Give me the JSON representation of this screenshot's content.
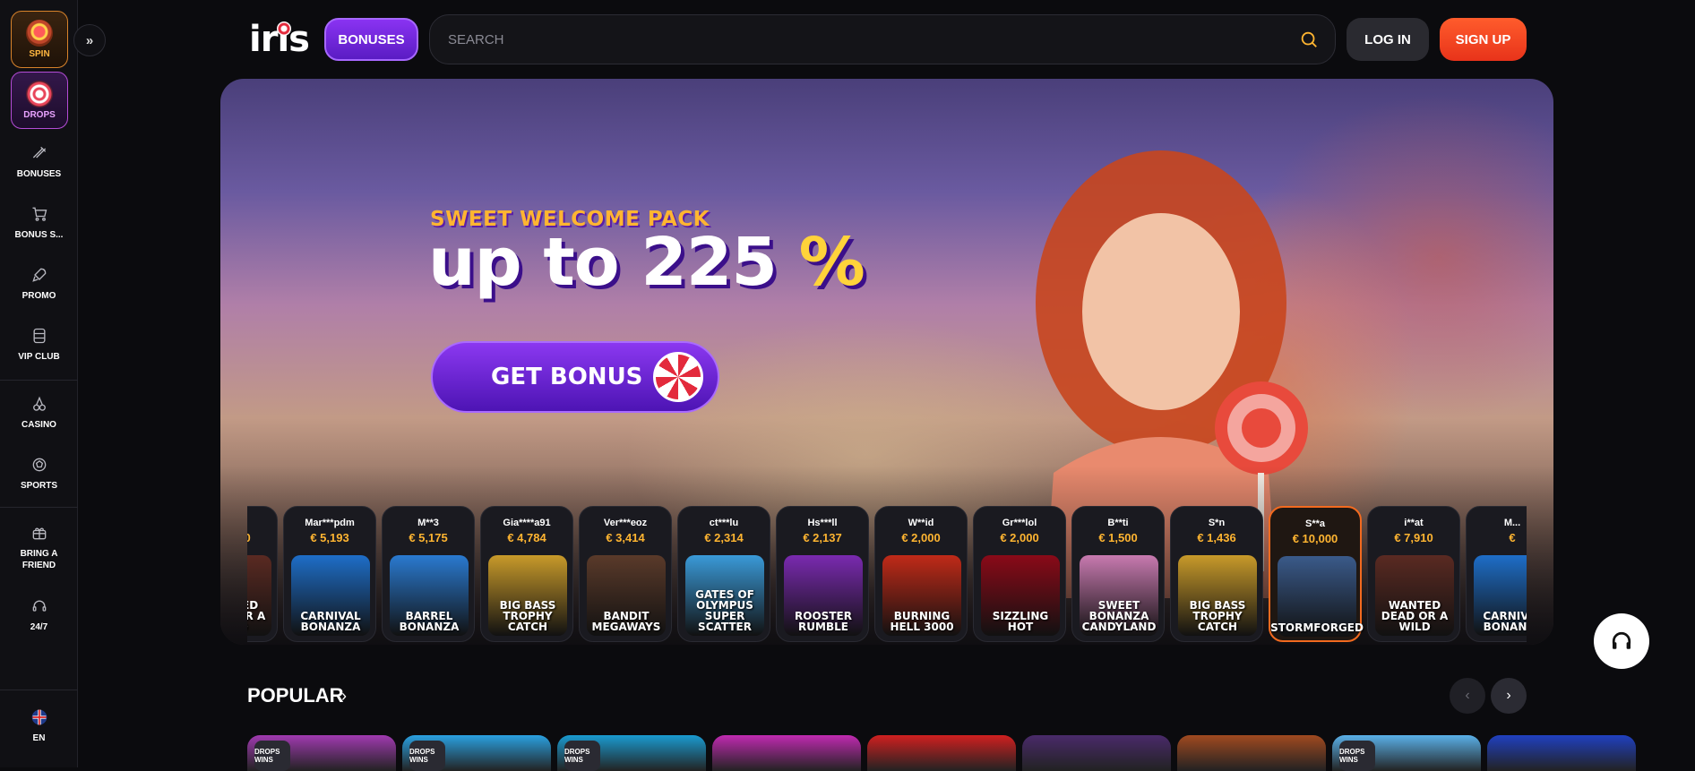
{
  "sidebar": {
    "spin_label": "SPIN",
    "drops_label": "DROPS",
    "items": [
      {
        "label": "BONUSES",
        "icon": "bonuses-icon"
      },
      {
        "label": "BONUS S...",
        "icon": "cart-icon"
      },
      {
        "label": "PROMO",
        "icon": "rocket-icon"
      },
      {
        "label": "VIP CLUB",
        "icon": "vip-icon"
      },
      {
        "label": "CASINO",
        "icon": "cherries-icon"
      },
      {
        "label": "SPORTS",
        "icon": "soccer-ball-icon"
      },
      {
        "label": "BRING A FRIEND",
        "icon": "gift-icon"
      },
      {
        "label": "24/7",
        "icon": "headset-icon"
      }
    ],
    "language": "EN"
  },
  "header": {
    "logo": "iris",
    "bonuses_label": "BONUSES",
    "search_placeholder": "SEARCH",
    "login_label": "LOG IN",
    "signup_label": "SIGN UP"
  },
  "hero": {
    "tag": "SWEET WELCOME PACK",
    "headline_prefix": "up to 225",
    "headline_suffix": "%",
    "cta_label": "GET BONUS"
  },
  "winners": [
    {
      "name": "i**at",
      "amount": "€ 7,910",
      "game": "WANTED DEAD OR A WILD",
      "color": "#5a2a22"
    },
    {
      "name": "Mar***pdm",
      "amount": "€ 5,193",
      "game": "CARNIVAL BONANZA",
      "color": "#1e6ec8"
    },
    {
      "name": "M**3",
      "amount": "€ 5,175",
      "game": "BARREL BONANZA",
      "color": "#2a7ad0"
    },
    {
      "name": "Gia****a91",
      "amount": "€ 4,784",
      "game": "BIG BASS TROPHY CATCH",
      "color": "#c89a2a"
    },
    {
      "name": "Ver***eoz",
      "amount": "€ 3,414",
      "game": "BANDIT MEGAWAYS",
      "color": "#5a3a2a"
    },
    {
      "name": "ct***lu",
      "amount": "€ 2,314",
      "game": "GATES OF OLYMPUS SUPER SCATTER",
      "color": "#3a9ad8"
    },
    {
      "name": "Hs***ll",
      "amount": "€ 2,137",
      "game": "ROOSTER RUMBLE",
      "color": "#7a2ab0"
    },
    {
      "name": "W**id",
      "amount": "€ 2,000",
      "game": "BURNING HELL 3000",
      "color": "#c02a18"
    },
    {
      "name": "Gr***lol",
      "amount": "€ 2,000",
      "game": "SIZZLING HOT",
      "color": "#8a0a18"
    },
    {
      "name": "B**ti",
      "amount": "€ 1,500",
      "game": "SWEET BONANZA CANDYLAND",
      "color": "#c87ab0"
    },
    {
      "name": "S*n",
      "amount": "€ 1,436",
      "game": "BIG BASS TROPHY CATCH",
      "color": "#c89a2a"
    },
    {
      "name": "S**a",
      "amount": "€ 10,000",
      "game": "STORMFORGED",
      "color": "#3a5a8a"
    },
    {
      "name": "i**at",
      "amount": "€ 7,910",
      "game": "WANTED DEAD OR A WILD",
      "color": "#5a2a22"
    },
    {
      "name": "M...",
      "amount": "€",
      "game": "CARNIVAL BONANZA",
      "color": "#1e6ec8"
    }
  ],
  "popular": {
    "title": "POPULAR",
    "badge": "DROPS WINS",
    "cards": [
      "#a03ab0",
      "#2aa0e0",
      "#1a9ad0",
      "#c02ab0",
      "#d02020",
      "#4a2a6a",
      "#a04a20",
      "#5ab0e8",
      "#2040c0"
    ]
  },
  "colors": {
    "accent_purple": "#7a2ee8",
    "signup_orange": "#ff4a22",
    "amount_gold": "#ffb531"
  }
}
